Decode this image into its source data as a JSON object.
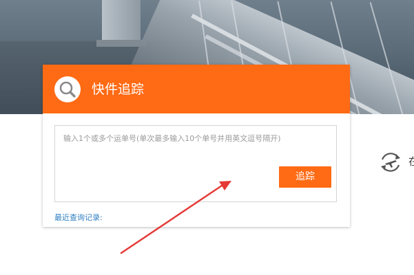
{
  "tracking_card": {
    "title": "快件追踪",
    "placeholder": "输入1个或多个运单号(单次最多输入10个单号并用英文逗号隔开)",
    "track_button_label": "追踪",
    "recent_queries_label": "最近查询记录:"
  },
  "side_feature": {
    "label_partial": "在"
  },
  "icons": {
    "header_icon": "search-icon",
    "side_icon": "refresh-plane-icon"
  },
  "colors": {
    "accent": "#ff6a14",
    "link": "#2f7fc1",
    "annotation_arrow": "#e53935"
  }
}
